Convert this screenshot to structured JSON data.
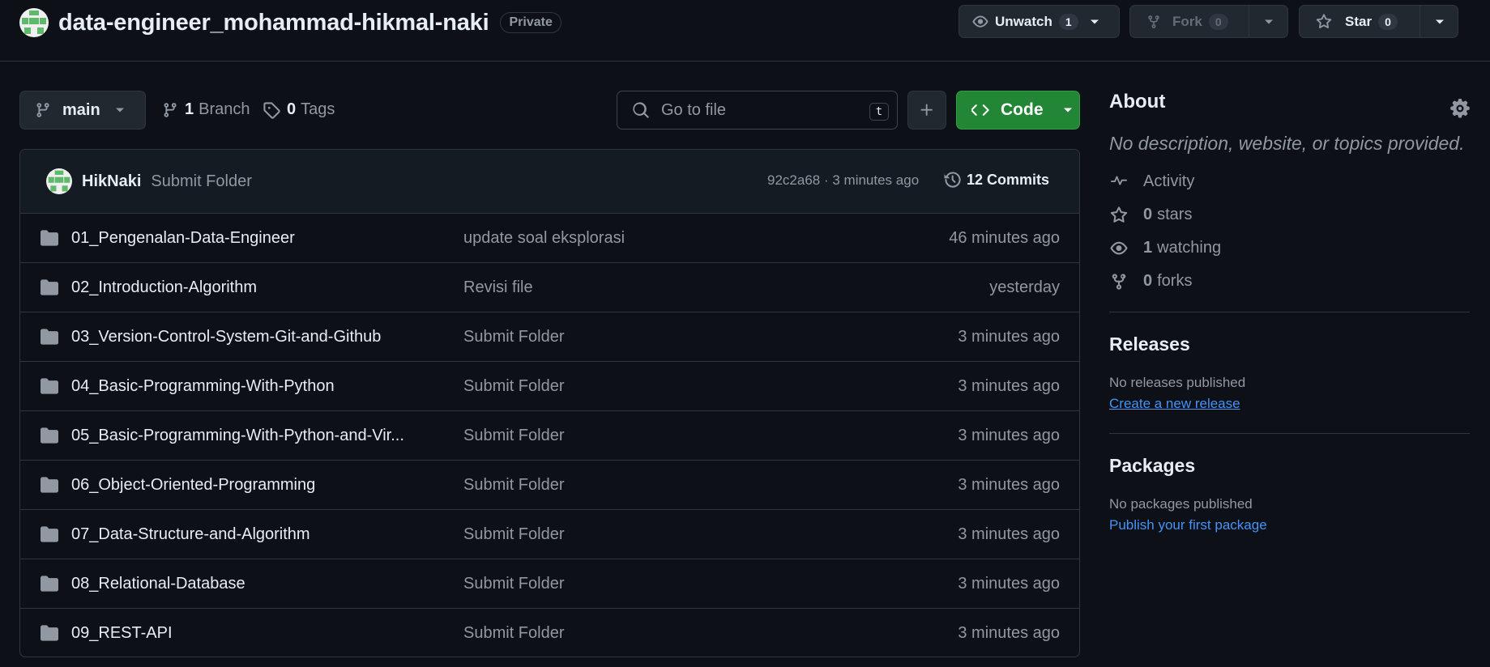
{
  "repo": {
    "name": "data-engineer_mohammad-hikmal-naki",
    "visibility": "Private"
  },
  "header_actions": {
    "watch_label": "Unwatch",
    "watch_count": "1",
    "fork_label": "Fork",
    "fork_count": "0",
    "star_label": "Star",
    "star_count": "0"
  },
  "toolbar": {
    "branch": "main",
    "branches_count": "1",
    "branches_label": "Branch",
    "tags_count": "0",
    "tags_label": "Tags",
    "search_placeholder": "Go to file",
    "search_shortcut": "t",
    "code_label": "Code"
  },
  "latest_commit": {
    "author": "HikNaki",
    "message": "Submit Folder",
    "hash": "92c2a68",
    "time": "3 minutes ago",
    "commits_label": "12 Commits"
  },
  "files": [
    {
      "name": "01_Pengenalan-Data-Engineer",
      "message": "update soal eksplorasi",
      "time": "46 minutes ago"
    },
    {
      "name": "02_Introduction-Algorithm",
      "message": "Revisi file",
      "time": "yesterday"
    },
    {
      "name": "03_Version-Control-System-Git-and-Github",
      "message": "Submit Folder",
      "time": "3 minutes ago"
    },
    {
      "name": "04_Basic-Programming-With-Python",
      "message": "Submit Folder",
      "time": "3 minutes ago"
    },
    {
      "name": "05_Basic-Programming-With-Python-and-Vir...",
      "message": "Submit Folder",
      "time": "3 minutes ago"
    },
    {
      "name": "06_Object-Oriented-Programming",
      "message": "Submit Folder",
      "time": "3 minutes ago"
    },
    {
      "name": "07_Data-Structure-and-Algorithm",
      "message": "Submit Folder",
      "time": "3 minutes ago"
    },
    {
      "name": "08_Relational-Database",
      "message": "Submit Folder",
      "time": "3 minutes ago"
    },
    {
      "name": "09_REST-API",
      "message": "Submit Folder",
      "time": "3 minutes ago"
    }
  ],
  "about": {
    "title": "About",
    "description": "No description, website, or topics provided.",
    "activity_label": "Activity",
    "stars_count": "0",
    "stars_label": "stars",
    "watching_count": "1",
    "watching_label": "watching",
    "forks_count": "0",
    "forks_label": "forks"
  },
  "releases": {
    "title": "Releases",
    "empty_text": "No releases published",
    "link": "Create a new release"
  },
  "packages": {
    "title": "Packages",
    "empty_text": "No packages published",
    "link": "Publish your first package"
  },
  "colors": {
    "background": "#0d1117",
    "accent_green": "#238636",
    "link_blue": "#4493f8",
    "border": "#30363d"
  },
  "icons": [
    "repo-avatar",
    "eye-icon",
    "fork-icon",
    "star-icon",
    "branch-icon",
    "tag-icon",
    "search-icon",
    "plus-icon",
    "code-icon",
    "history-icon",
    "folder-icon",
    "gear-icon",
    "pulse-icon",
    "caret-down-icon"
  ]
}
